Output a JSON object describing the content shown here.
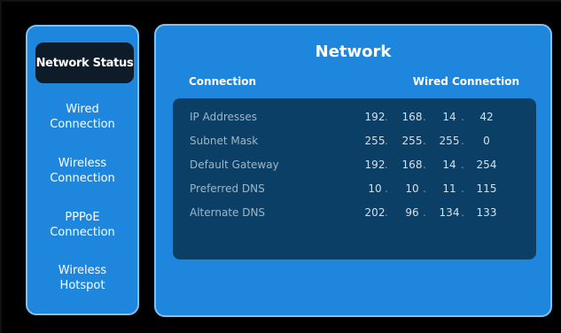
{
  "sidebar": {
    "items": [
      {
        "label": "Network Status",
        "active": true
      },
      {
        "label": "Wired\nConnection",
        "active": false
      },
      {
        "label": "Wireless\nConnection",
        "active": false
      },
      {
        "label": "PPPoE\nConnection",
        "active": false
      },
      {
        "label": "Wireless\nHotspot",
        "active": false
      }
    ]
  },
  "panel": {
    "title": "Network",
    "connection_label": "Connection",
    "connection_value": "Wired Connection",
    "rows": [
      {
        "label": "IP Addresses",
        "octets": [
          "192",
          "168",
          "14",
          "42"
        ]
      },
      {
        "label": "Subnet Mask",
        "octets": [
          "255",
          "255",
          "255",
          "0"
        ]
      },
      {
        "label": "Default Gateway",
        "octets": [
          "192",
          "168",
          "14",
          "254"
        ]
      },
      {
        "label": "Preferred DNS",
        "octets": [
          "10",
          "10",
          "11",
          "115"
        ]
      },
      {
        "label": "Alternate DNS",
        "octets": [
          "202",
          "96",
          "134",
          "133"
        ]
      }
    ],
    "separator": "."
  },
  "colors": {
    "background": "#000000",
    "panel": "#1f86dd",
    "panel_border": "#7fc2f2",
    "active_item": "#0e1c2a",
    "info_box": "#0b3f66"
  }
}
